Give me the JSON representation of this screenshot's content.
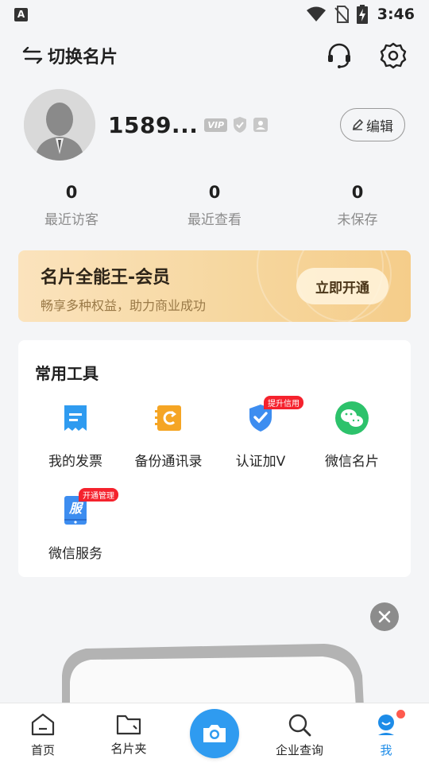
{
  "status_bar": {
    "app_indicator": "A",
    "time": "3:46"
  },
  "top_nav": {
    "switch_card_label": "切换名片"
  },
  "profile": {
    "name": "1589...",
    "vip_badge": "VIP",
    "edit_label": "编辑"
  },
  "stats": [
    {
      "value": "0",
      "label": "最近访客"
    },
    {
      "value": "0",
      "label": "最近查看"
    },
    {
      "value": "0",
      "label": "未保存"
    }
  ],
  "vip_banner": {
    "title": "名片全能王-会员",
    "subtitle": "畅享多种权益，助力商业成功",
    "button": "立即开通"
  },
  "tools": {
    "title": "常用工具",
    "items": [
      {
        "label": "我的发票",
        "icon": "invoice-icon"
      },
      {
        "label": "备份通讯录",
        "icon": "backup-contacts-icon"
      },
      {
        "label": "认证加V",
        "icon": "verify-shield-icon",
        "tag": "提升信用"
      },
      {
        "label": "微信名片",
        "icon": "wechat-icon"
      },
      {
        "label": "微信服务",
        "icon": "wechat-service-icon",
        "tag": "开通管理"
      }
    ]
  },
  "bottom_nav": [
    {
      "label": "首页",
      "icon": "home-icon"
    },
    {
      "label": "名片夹",
      "icon": "folder-icon"
    },
    {
      "label": "企业查询",
      "icon": "search-icon"
    },
    {
      "label": "我",
      "icon": "me-icon",
      "active": true
    }
  ],
  "colors": {
    "accent": "#2f9bf0",
    "active_tab": "#1d8ce8",
    "vip_gold": "#f6d79f",
    "badge_red": "#f5222d"
  }
}
